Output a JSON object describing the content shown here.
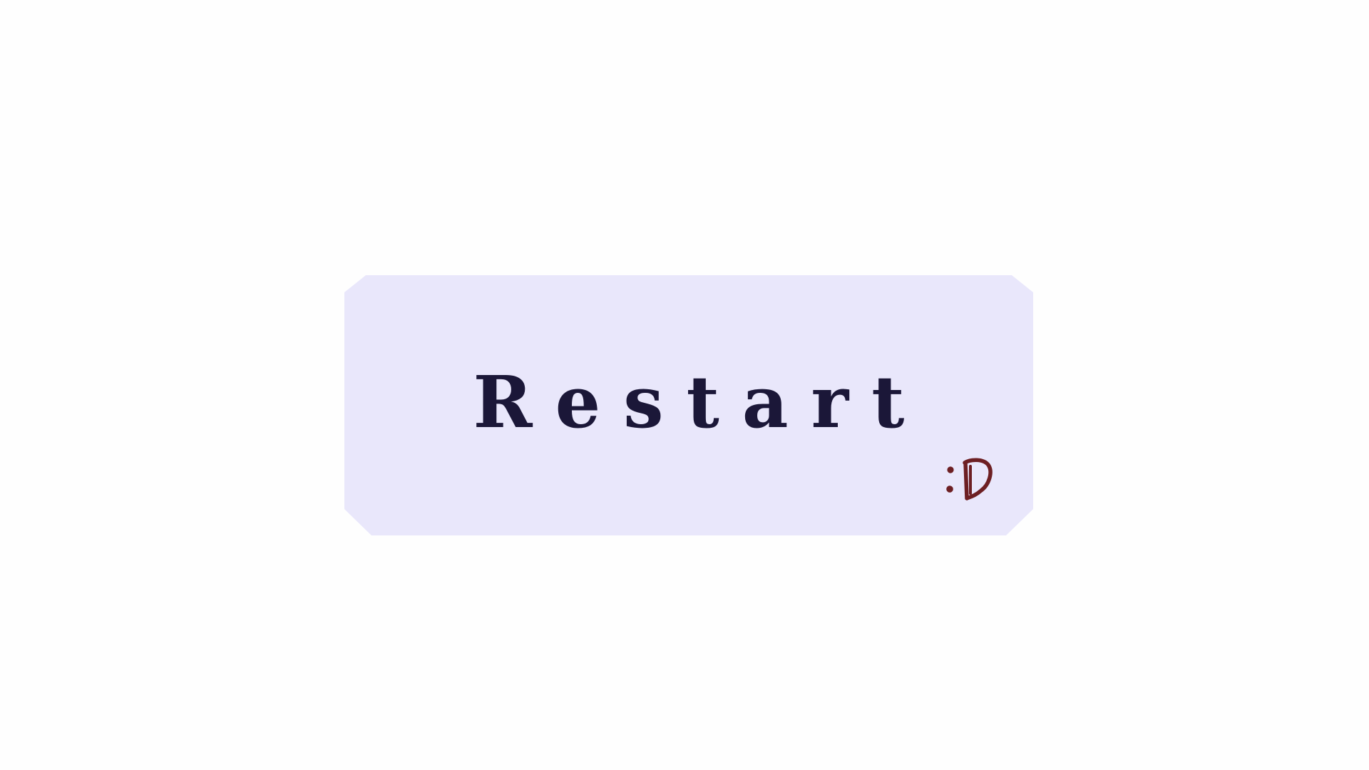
{
  "restart_button": {
    "label": "Restart",
    "background": "#e9e7fb",
    "text_color": "#1b1738"
  },
  "doodle": {
    "text": ":D",
    "color": "#6d1f23",
    "icon": "smiley-doodle-icon"
  }
}
